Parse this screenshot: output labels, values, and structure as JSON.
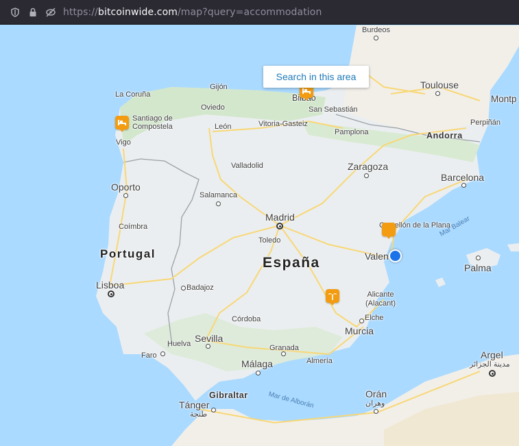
{
  "browser": {
    "url_scheme": "https://",
    "url_host": "bitcoinwide.com",
    "url_path": "/map?query=accommodation",
    "icons": [
      "shield-icon",
      "lock-icon",
      "tracking-off-icon"
    ]
  },
  "map": {
    "search_button_label": "Search in this area",
    "country_labels": {
      "spain": "España",
      "portugal": "Portugal"
    },
    "sea_labels": {
      "balearic": "Mar Balear",
      "alboran": "Mar de Alborán"
    },
    "cities": {
      "burdeos": "Burdeos",
      "toulouse": "Toulouse",
      "montpellier": "Montp",
      "perpignan": "Perpiñán",
      "andorra": "Andorra",
      "la_coruna": "La Coruña",
      "gijon": "Gijón",
      "oviedo": "Oviedo",
      "bilbao": "Bilbao",
      "san_sebastian": "San Sebastián",
      "santiago": "Santiago de\nCompostela",
      "leon": "León",
      "vitoria": "Vitoria-Gasteiz",
      "pamplona": "Pamplona",
      "vigo": "Vigo",
      "valladolid": "Valladolid",
      "zaragoza": "Zaragoza",
      "barcelona": "Barcelona",
      "oporto": "Oporto",
      "salamanca": "Salamanca",
      "madrid": "Madrid",
      "castellon": "Castellón de la Plana",
      "coimbra": "Coímbra",
      "toledo": "Toledo",
      "valencia": "Valencia",
      "palma": "Palma",
      "lisboa": "Lisboa",
      "badajoz": "Badajoz",
      "alicante": "Alicante\n(Alacant)",
      "cordoba": "Córdoba",
      "elche": "Elche",
      "sevilla": "Sevilla",
      "murcia": "Murcia",
      "huelva": "Huelva",
      "granada": "Granada",
      "faro": "Faro",
      "almeria": "Almería",
      "malaga": "Málaga",
      "argel": "Argel",
      "argel_ar": "مدينة الجزائر",
      "gibraltar": "Gibraltar",
      "oran": "Orán",
      "oran_ar": "وهران",
      "tanger": "Tánger",
      "tanger_ar": "طنجة"
    }
  }
}
